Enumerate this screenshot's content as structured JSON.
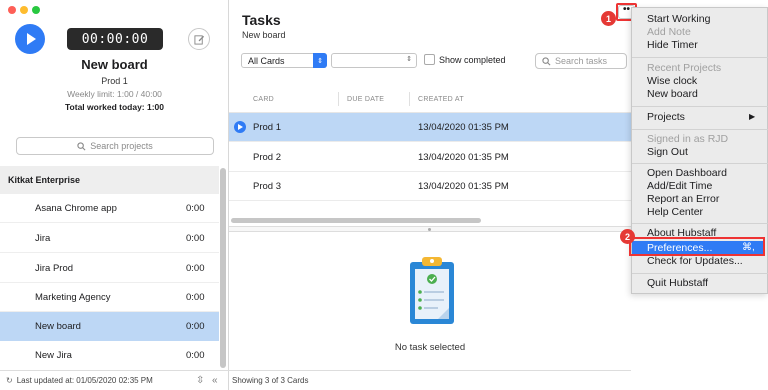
{
  "left": {
    "timer": "00:00:00",
    "board_title": "New board",
    "board_project": "Prod 1",
    "weekly_limit": "Weekly limit: 1:00 / 40:00",
    "total_worked": "Total worked today:  1:00",
    "search_placeholder": "Search projects",
    "org_name": "Kitkat Enterprise",
    "projects": [
      {
        "name": "Asana Chrome app",
        "time": "0:00"
      },
      {
        "name": "Jira",
        "time": "0:00"
      },
      {
        "name": "Jira Prod",
        "time": "0:00"
      },
      {
        "name": "Marketing Agency",
        "time": "0:00"
      },
      {
        "name": "New board",
        "time": "0:00",
        "selected": true
      },
      {
        "name": "New Jira",
        "time": "0:00"
      }
    ],
    "footer": "Last updated at: 01/05/2020 02:35 PM"
  },
  "main": {
    "title": "Tasks",
    "subtitle": "New board",
    "cards_filter": "All Cards",
    "show_completed": "Show completed",
    "search_placeholder": "Search tasks",
    "columns": {
      "card": "CARD",
      "due_date": "DUE DATE",
      "created_at": "CREATED AT"
    },
    "tasks": [
      {
        "card": "Prod 1",
        "due": "",
        "created": "13/04/2020 01:35 PM",
        "selected": true
      },
      {
        "card": "Prod 2",
        "due": "",
        "created": "13/04/2020 01:35 PM"
      },
      {
        "card": "Prod 3",
        "due": "",
        "created": "13/04/2020 01:35 PM"
      }
    ],
    "empty_text": "No task selected",
    "footer": "Showing 3 of 3 Cards",
    "more_button": "••"
  },
  "menu": {
    "start_working": "Start Working",
    "add_note": "Add Note",
    "hide_timer": "Hide Timer",
    "recent_projects": "Recent Projects",
    "recent_1": "Wise clock",
    "recent_2": "New board",
    "projects": "Projects",
    "signed_in": "Signed in as RJD",
    "sign_out": "Sign Out",
    "open_dashboard": "Open Dashboard",
    "add_edit_time": "Add/Edit Time",
    "report_error": "Report an Error",
    "help_center": "Help Center",
    "about": "About Hubstaff",
    "preferences": "Preferences...",
    "preferences_shortcut": "⌘,",
    "check_updates": "Check for Updates...",
    "quit": "Quit Hubstaff"
  },
  "annotations": {
    "badge1": "1",
    "badge2": "2"
  },
  "colors": {
    "accent": "#2f7bf5",
    "selection": "#bdd7f5",
    "annotation": "#e53935"
  }
}
